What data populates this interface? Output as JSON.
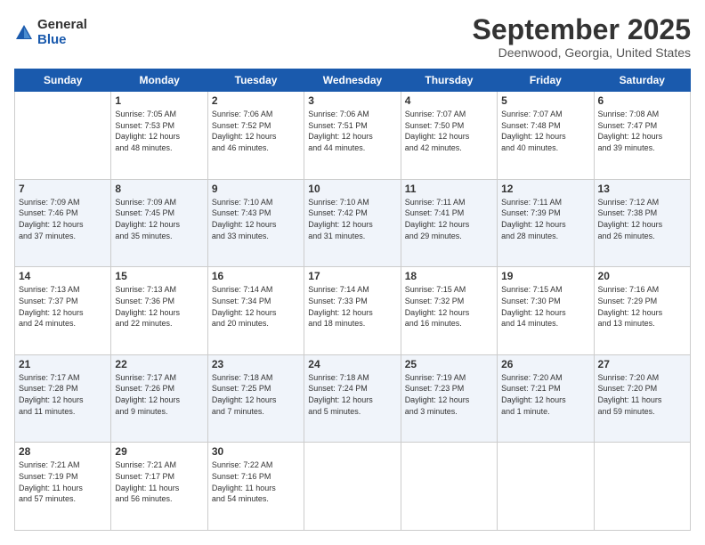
{
  "logo": {
    "general": "General",
    "blue": "Blue"
  },
  "title": "September 2025",
  "location": "Deenwood, Georgia, United States",
  "days_header": [
    "Sunday",
    "Monday",
    "Tuesday",
    "Wednesday",
    "Thursday",
    "Friday",
    "Saturday"
  ],
  "weeks": [
    [
      {
        "day": "",
        "info": ""
      },
      {
        "day": "1",
        "info": "Sunrise: 7:05 AM\nSunset: 7:53 PM\nDaylight: 12 hours\nand 48 minutes."
      },
      {
        "day": "2",
        "info": "Sunrise: 7:06 AM\nSunset: 7:52 PM\nDaylight: 12 hours\nand 46 minutes."
      },
      {
        "day": "3",
        "info": "Sunrise: 7:06 AM\nSunset: 7:51 PM\nDaylight: 12 hours\nand 44 minutes."
      },
      {
        "day": "4",
        "info": "Sunrise: 7:07 AM\nSunset: 7:50 PM\nDaylight: 12 hours\nand 42 minutes."
      },
      {
        "day": "5",
        "info": "Sunrise: 7:07 AM\nSunset: 7:48 PM\nDaylight: 12 hours\nand 40 minutes."
      },
      {
        "day": "6",
        "info": "Sunrise: 7:08 AM\nSunset: 7:47 PM\nDaylight: 12 hours\nand 39 minutes."
      }
    ],
    [
      {
        "day": "7",
        "info": "Sunrise: 7:09 AM\nSunset: 7:46 PM\nDaylight: 12 hours\nand 37 minutes."
      },
      {
        "day": "8",
        "info": "Sunrise: 7:09 AM\nSunset: 7:45 PM\nDaylight: 12 hours\nand 35 minutes."
      },
      {
        "day": "9",
        "info": "Sunrise: 7:10 AM\nSunset: 7:43 PM\nDaylight: 12 hours\nand 33 minutes."
      },
      {
        "day": "10",
        "info": "Sunrise: 7:10 AM\nSunset: 7:42 PM\nDaylight: 12 hours\nand 31 minutes."
      },
      {
        "day": "11",
        "info": "Sunrise: 7:11 AM\nSunset: 7:41 PM\nDaylight: 12 hours\nand 29 minutes."
      },
      {
        "day": "12",
        "info": "Sunrise: 7:11 AM\nSunset: 7:39 PM\nDaylight: 12 hours\nand 28 minutes."
      },
      {
        "day": "13",
        "info": "Sunrise: 7:12 AM\nSunset: 7:38 PM\nDaylight: 12 hours\nand 26 minutes."
      }
    ],
    [
      {
        "day": "14",
        "info": "Sunrise: 7:13 AM\nSunset: 7:37 PM\nDaylight: 12 hours\nand 24 minutes."
      },
      {
        "day": "15",
        "info": "Sunrise: 7:13 AM\nSunset: 7:36 PM\nDaylight: 12 hours\nand 22 minutes."
      },
      {
        "day": "16",
        "info": "Sunrise: 7:14 AM\nSunset: 7:34 PM\nDaylight: 12 hours\nand 20 minutes."
      },
      {
        "day": "17",
        "info": "Sunrise: 7:14 AM\nSunset: 7:33 PM\nDaylight: 12 hours\nand 18 minutes."
      },
      {
        "day": "18",
        "info": "Sunrise: 7:15 AM\nSunset: 7:32 PM\nDaylight: 12 hours\nand 16 minutes."
      },
      {
        "day": "19",
        "info": "Sunrise: 7:15 AM\nSunset: 7:30 PM\nDaylight: 12 hours\nand 14 minutes."
      },
      {
        "day": "20",
        "info": "Sunrise: 7:16 AM\nSunset: 7:29 PM\nDaylight: 12 hours\nand 13 minutes."
      }
    ],
    [
      {
        "day": "21",
        "info": "Sunrise: 7:17 AM\nSunset: 7:28 PM\nDaylight: 12 hours\nand 11 minutes."
      },
      {
        "day": "22",
        "info": "Sunrise: 7:17 AM\nSunset: 7:26 PM\nDaylight: 12 hours\nand 9 minutes."
      },
      {
        "day": "23",
        "info": "Sunrise: 7:18 AM\nSunset: 7:25 PM\nDaylight: 12 hours\nand 7 minutes."
      },
      {
        "day": "24",
        "info": "Sunrise: 7:18 AM\nSunset: 7:24 PM\nDaylight: 12 hours\nand 5 minutes."
      },
      {
        "day": "25",
        "info": "Sunrise: 7:19 AM\nSunset: 7:23 PM\nDaylight: 12 hours\nand 3 minutes."
      },
      {
        "day": "26",
        "info": "Sunrise: 7:20 AM\nSunset: 7:21 PM\nDaylight: 12 hours\nand 1 minute."
      },
      {
        "day": "27",
        "info": "Sunrise: 7:20 AM\nSunset: 7:20 PM\nDaylight: 11 hours\nand 59 minutes."
      }
    ],
    [
      {
        "day": "28",
        "info": "Sunrise: 7:21 AM\nSunset: 7:19 PM\nDaylight: 11 hours\nand 57 minutes."
      },
      {
        "day": "29",
        "info": "Sunrise: 7:21 AM\nSunset: 7:17 PM\nDaylight: 11 hours\nand 56 minutes."
      },
      {
        "day": "30",
        "info": "Sunrise: 7:22 AM\nSunset: 7:16 PM\nDaylight: 11 hours\nand 54 minutes."
      },
      {
        "day": "",
        "info": ""
      },
      {
        "day": "",
        "info": ""
      },
      {
        "day": "",
        "info": ""
      },
      {
        "day": "",
        "info": ""
      }
    ]
  ]
}
